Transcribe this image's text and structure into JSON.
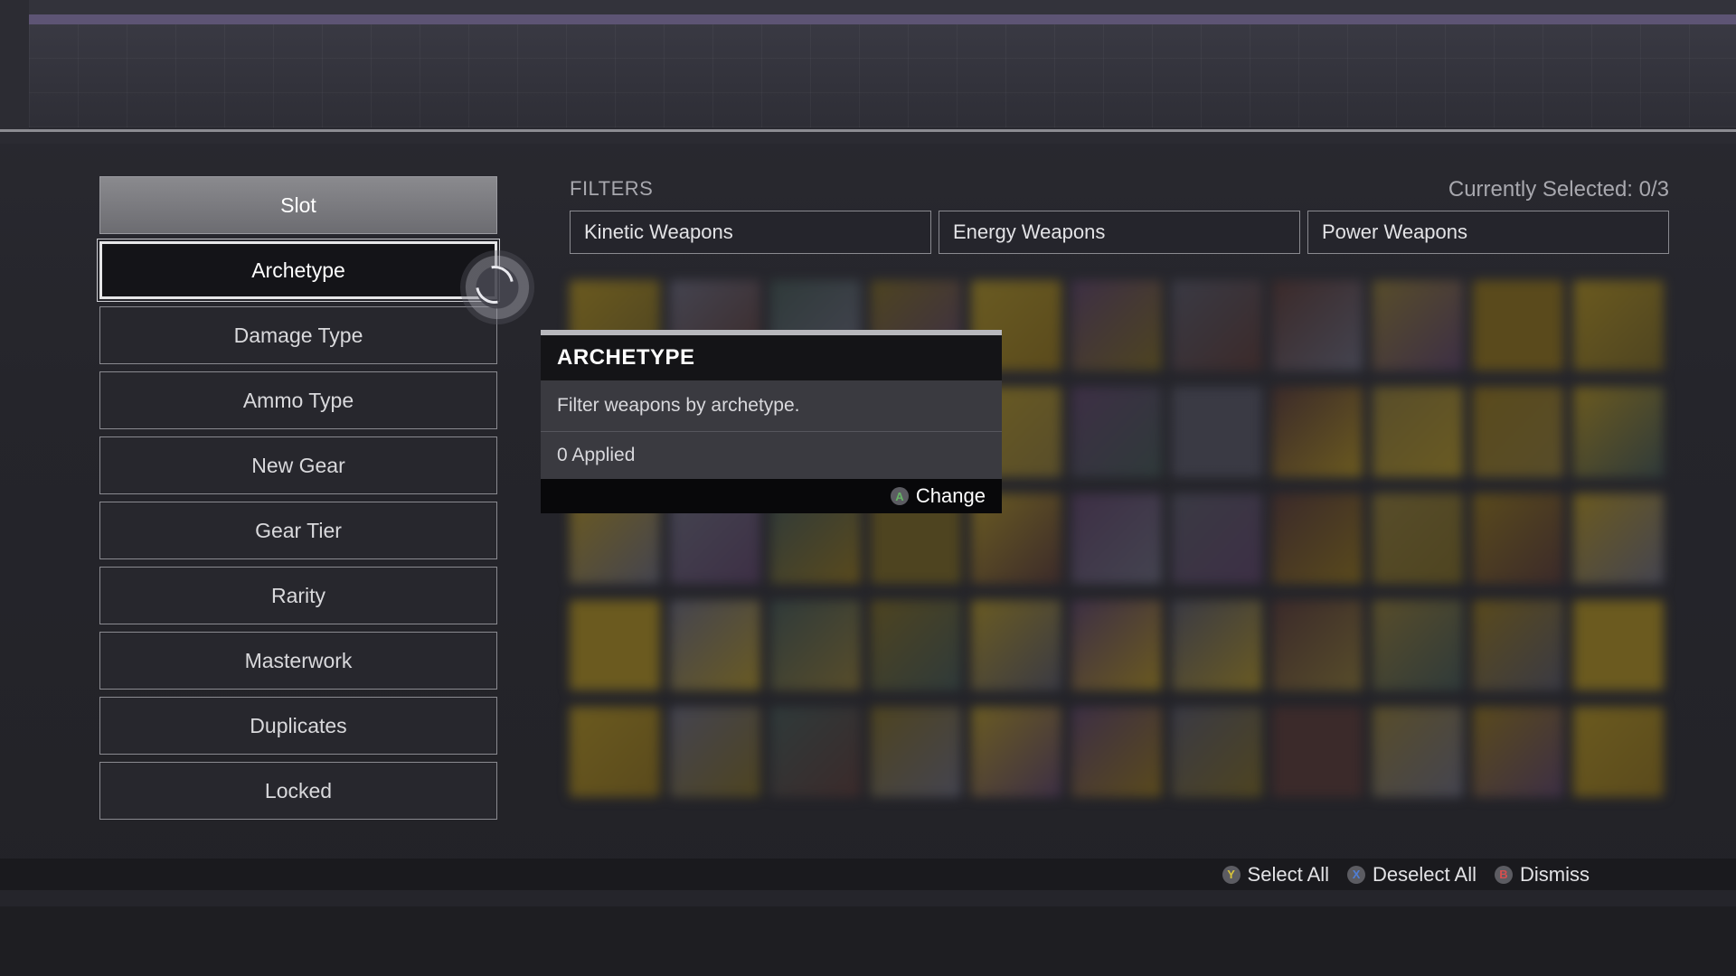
{
  "categories": [
    {
      "label": "Slot"
    },
    {
      "label": "Archetype"
    },
    {
      "label": "Damage Type"
    },
    {
      "label": "Ammo Type"
    },
    {
      "label": "New Gear"
    },
    {
      "label": "Gear Tier"
    },
    {
      "label": "Rarity"
    },
    {
      "label": "Masterwork"
    },
    {
      "label": "Duplicates"
    },
    {
      "label": "Locked"
    }
  ],
  "filters": {
    "label": "FILTERS",
    "currently_selected": "Currently Selected: 0/3",
    "options": [
      "Kinetic Weapons",
      "Energy Weapons",
      "Power Weapons"
    ]
  },
  "tooltip": {
    "title": "ARCHETYPE",
    "description": "Filter weapons by archetype.",
    "applied": "0 Applied",
    "action_label": "Change",
    "action_button": "A"
  },
  "bottom_actions": [
    {
      "button": "Y",
      "label": "Select All"
    },
    {
      "button": "X",
      "label": "Deselect All"
    },
    {
      "button": "B",
      "label": "Dismiss"
    }
  ],
  "colors": {
    "header_accent": "#5d5474",
    "button_a": "#66b466",
    "button_y": "#d9c43a",
    "button_x": "#4f7ed6",
    "button_b": "#d64f4f"
  }
}
